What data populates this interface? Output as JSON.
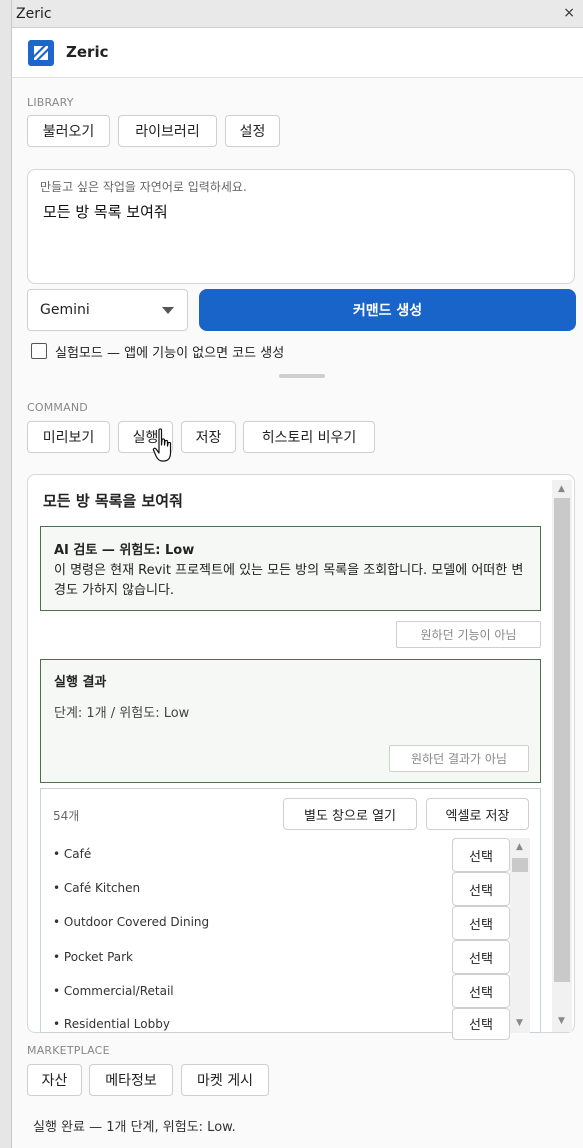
{
  "window": {
    "title": "Zeric",
    "close_glyph": "×"
  },
  "header": {
    "brand": "Zeric",
    "logo_icon": "zeric-logo-icon",
    "brand_color": "#1e66cc"
  },
  "library": {
    "label": "LIBRARY",
    "buttons": [
      "불러오기",
      "라이브러리",
      "설정"
    ]
  },
  "prompt": {
    "placeholder": "만들고 싶은 작업을 자연어로 입력하세요.",
    "value": "모든 방 목록 보여줘"
  },
  "model_select": {
    "value": "Gemini"
  },
  "generate_button": {
    "label": "커맨드 생성",
    "color": "#1864c8"
  },
  "experimental": {
    "label": "실험모드 — 앱에 기능이 없으면 코드 생성",
    "checked": false
  },
  "command": {
    "label": "COMMAND",
    "buttons": [
      "미리보기",
      "실행",
      "저장",
      "히스토리 비우기"
    ]
  },
  "card": {
    "title": "모든 방 목록을 보여줘",
    "ai_review": {
      "heading": "AI 검토 — 위험도: Low",
      "description": "이 명령은 현재 Revit 프로젝트에 있는 모든 방의 목록을 조회합니다. 모델에 어떠한 변경도 가하지 않습니다.",
      "feedback_button": "원하던 기능이 아님"
    },
    "result": {
      "heading": "실행 결과",
      "detail": "단계: 1개 / 위험도: Low",
      "feedback_button": "원하던 결과가 아님"
    },
    "list": {
      "count": "54개",
      "open_window_button": "별도 창으로 열기",
      "save_excel_button": "엑셀로 저장",
      "select_label": "선택",
      "items": [
        "• Café",
        "• Café Kitchen",
        "• Outdoor Covered Dining",
        "• Pocket Park",
        "• Commercial/Retail",
        "• Residential Lobby"
      ]
    }
  },
  "marketplace": {
    "label": "MARKETPLACE",
    "buttons": [
      "자산",
      "메타정보",
      "마켓 게시"
    ]
  },
  "status": "실행 완료 — 1개 단계, 위험도: Low."
}
